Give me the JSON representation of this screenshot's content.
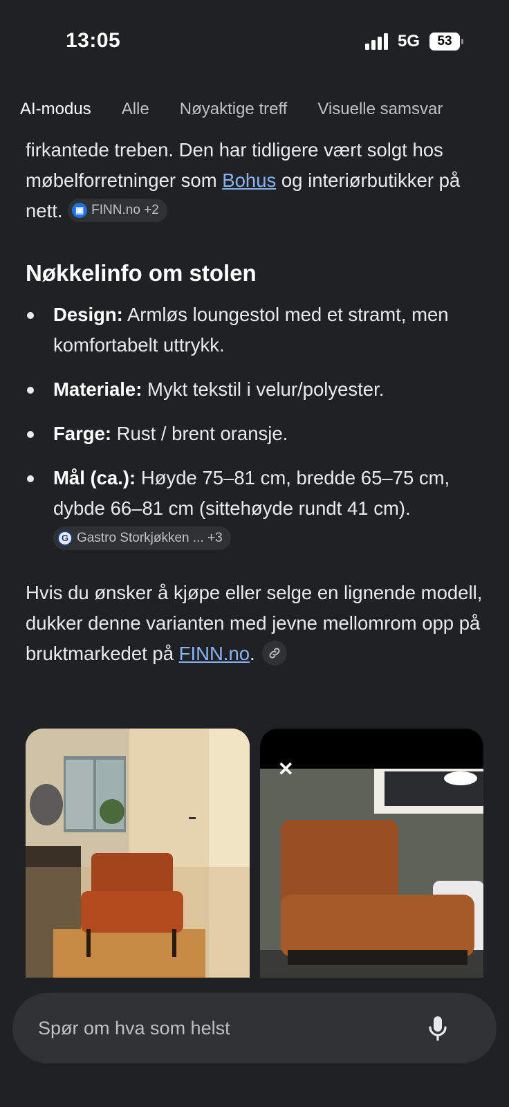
{
  "status_bar": {
    "time": "13:05",
    "network": "5G",
    "battery": "53"
  },
  "tabs": [
    {
      "label": "AI-modus",
      "active": true
    },
    {
      "label": "Alle",
      "active": false
    },
    {
      "label": "Nøyaktige treff",
      "active": false
    },
    {
      "label": "Visuelle samsvar",
      "active": false
    }
  ],
  "intro": {
    "text_before_link": "firkantede treben. Den har tidligere vært solgt hos møbelforretninger som ",
    "link": "Bohus",
    "text_after_link": " og interiørbutikker på nett.",
    "chip": {
      "icon": "finn-icon",
      "label": "FINN.no +2"
    }
  },
  "section": {
    "heading": "Nøkkelinfo om stolen",
    "facts": [
      {
        "label": "Design:",
        "text": " Armløs loungestol med et stramt, men komfortabelt uttrykk."
      },
      {
        "label": "Materiale:",
        "text": " Mykt tekstil i velur/polyester."
      },
      {
        "label": "Farge:",
        "text": " Rust / brent oransje."
      },
      {
        "label": "Mål (ca.):",
        "text": " Høyde 75–81 cm, bredde 65–75 cm, dybde 66–81 cm (sittehøyde rundt 41 cm).",
        "chip": {
          "icon": "g-icon",
          "label": "Gastro Storkjøkken ... +3"
        }
      }
    ]
  },
  "outro": {
    "text": "Hvis du ønsker å kjøpe eller selge en lignende modell, dukker denne varianten med jevne mellomrom opp på bruktmarkedet på ",
    "link": "FINN.no",
    "after": "."
  },
  "images": {
    "close_label": "✕"
  },
  "search": {
    "placeholder": "Spør om hva som helst"
  },
  "colors": {
    "background": "#202124",
    "link": "#8ab4f8",
    "chip_bg": "#303134"
  }
}
